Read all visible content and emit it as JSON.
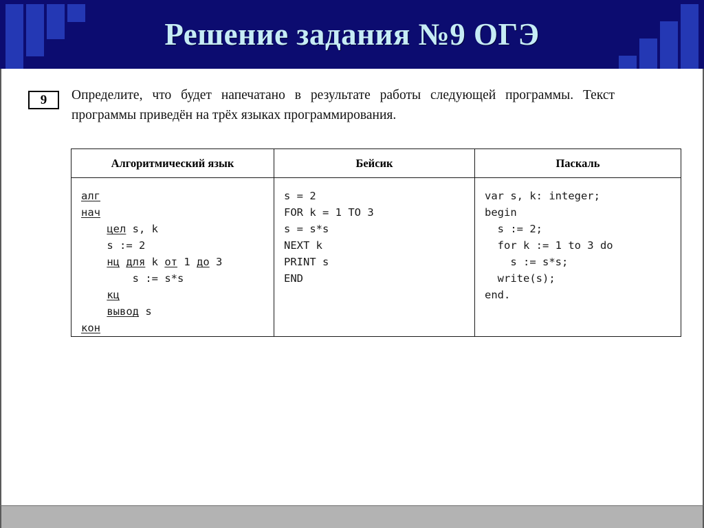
{
  "header": {
    "title": "Решение задания №9 ОГЭ",
    "background_color": "#0c0c70",
    "title_color": "#c6ecf5",
    "square_color": "#2438b4"
  },
  "task": {
    "number_badge": "9",
    "instruction": "Определите, что будет напечатано в результате работы следующей программы. Текст программы приведён на трёх языках программирования."
  },
  "table": {
    "headers": [
      "Алгоритмический язык",
      "Бейсик",
      "Паскаль"
    ],
    "code": {
      "algorithmic": "алг\nнач\n    цел s, k\n    s := 2\n    нц для k от 1 до 3\n        s := s*s\n    кц\n    вывод s\nкон",
      "basic": "s = 2\nFOR k = 1 TO 3\ns = s*s\nNEXT k\nPRINT s\nEND",
      "pascal": "var s, k: integer;\nbegin\n  s := 2;\n  for k := 1 to 3 do\n    s := s*s;\n  write(s);\nend."
    },
    "keywords_underlined": [
      "алг",
      "нач",
      "цел",
      "нц",
      "для",
      "от",
      "до",
      "кц",
      "вывод",
      "кон"
    ]
  },
  "footer": {
    "bar_color": "#b3b3b3"
  }
}
